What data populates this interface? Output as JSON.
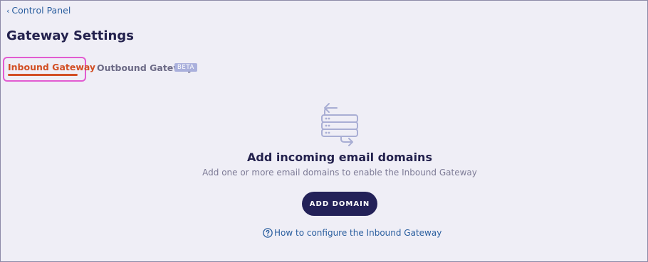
{
  "breadcrumb": {
    "chevron": "‹",
    "label": "Control Panel"
  },
  "page": {
    "title": "Gateway Settings"
  },
  "tabs": [
    {
      "label": "Inbound Gateway",
      "active": true
    },
    {
      "label": "Outbound Gateway",
      "badge": "BETA",
      "active": false
    }
  ],
  "empty_state": {
    "icon": "server-transfer-icon",
    "title": "Add incoming email domains",
    "subtitle": "Add one or more email domains to enable the Inbound Gateway",
    "button_label": "ADD DOMAIN",
    "help_icon": "question-circle-icon",
    "help_link": "How to configure the Inbound Gateway"
  },
  "colors": {
    "background": "#efeef6",
    "active_tab": "#d24f25",
    "primary_button": "#232158",
    "link": "#2b5f9f",
    "highlight": "#e25bd1",
    "badge": "#aab0dc"
  }
}
